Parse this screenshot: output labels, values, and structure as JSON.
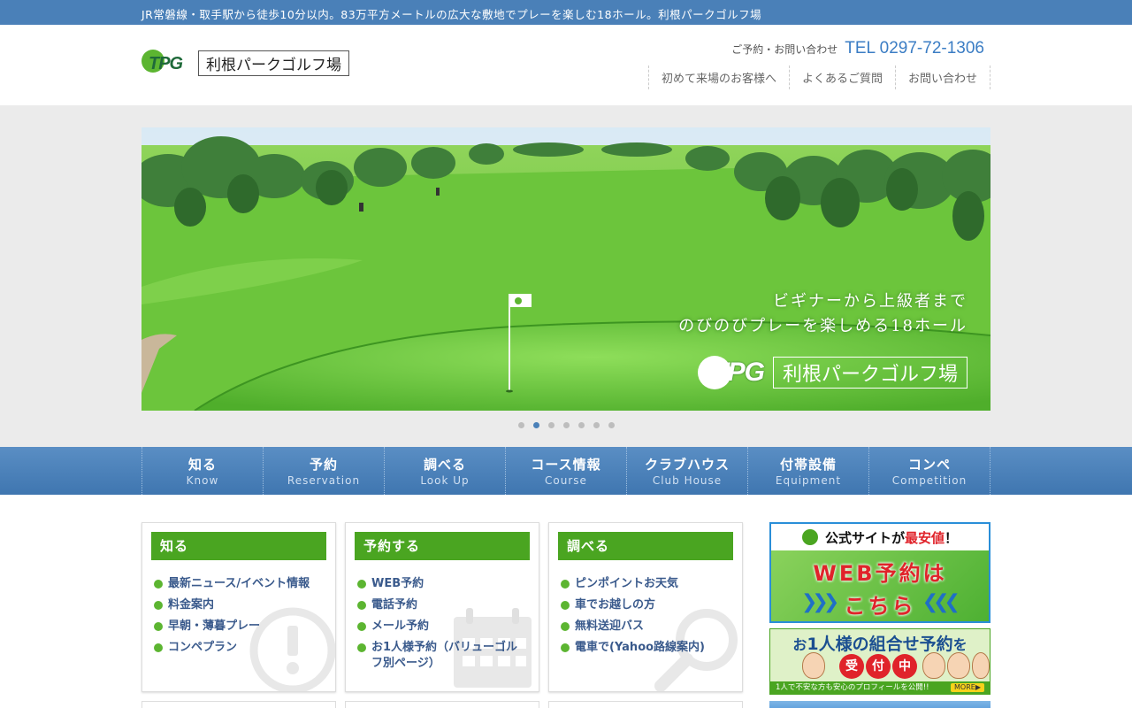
{
  "topbar": {
    "text": "JR常磐線・取手駅から徒歩10分以内。83万平方メートルの広大な敷地でプレーを楽しむ18ホール。利根パークゴルフ場"
  },
  "header": {
    "logo_mark": "TPG",
    "logo_name": "利根パークゴルフ場",
    "tel_label": "ご予約・お問い合わせ",
    "tel_number": "TEL 0297-72-1306",
    "nav": [
      "初めて来場のお客様へ",
      "よくあるご質問",
      "お問い合わせ"
    ]
  },
  "hero": {
    "copy_line1": "ビギナーから上級者まで",
    "copy_line2": "のびのびプレーを楽しめる18ホール",
    "logo_mark": "TPG",
    "logo_name": "利根パークゴルフ場",
    "slide_count": 7,
    "active_slide": 2
  },
  "main_nav": [
    {
      "jp": "知る",
      "en": "Know"
    },
    {
      "jp": "予約",
      "en": "Reservation"
    },
    {
      "jp": "調べる",
      "en": "Look Up"
    },
    {
      "jp": "コース情報",
      "en": "Course"
    },
    {
      "jp": "クラブハウス",
      "en": "Club House"
    },
    {
      "jp": "付帯設備",
      "en": "Equipment"
    },
    {
      "jp": "コンペ",
      "en": "Competition"
    }
  ],
  "boxes": [
    {
      "title": "知る",
      "icon": "exclamation-icon",
      "links": [
        "最新ニュース/イベント情報",
        "料金案内",
        "早朝・薄暮プレー",
        "コンペプラン"
      ]
    },
    {
      "title": "予約する",
      "icon": "calendar-icon",
      "links": [
        "WEB予約",
        "電話予約",
        "メール予約",
        "お1人様予約（バリューゴルフ別ページ）"
      ]
    },
    {
      "title": "調べる",
      "icon": "magnifier-icon",
      "links": [
        "ピンポイントお天気",
        "車でお越しの方",
        "無料送迎バス",
        "電車で(Yahoo路線案内)"
      ]
    }
  ],
  "banners": {
    "web": {
      "line_pre": "公式サイトが",
      "line_red": "最安値",
      "line_post": "！",
      "big1": "WEB予約は",
      "big2": "こちら",
      "arrows_left": "❯❯❯",
      "arrows_right": "❮❮❮"
    },
    "solo": {
      "title_pre": "お",
      "title_big": "1人様の組合せ予約",
      "title_post": "を",
      "badge": [
        "受",
        "付",
        "中"
      ],
      "footer": "1人で不安な方も安心のプロフィールを公開!!",
      "more": "MORE▶"
    }
  },
  "colors": {
    "topbar": "#4a80b8",
    "nav": "#4a80b8",
    "accent_green": "#4aa521",
    "tel": "#3b7dc4",
    "link": "#3a5a8c"
  }
}
